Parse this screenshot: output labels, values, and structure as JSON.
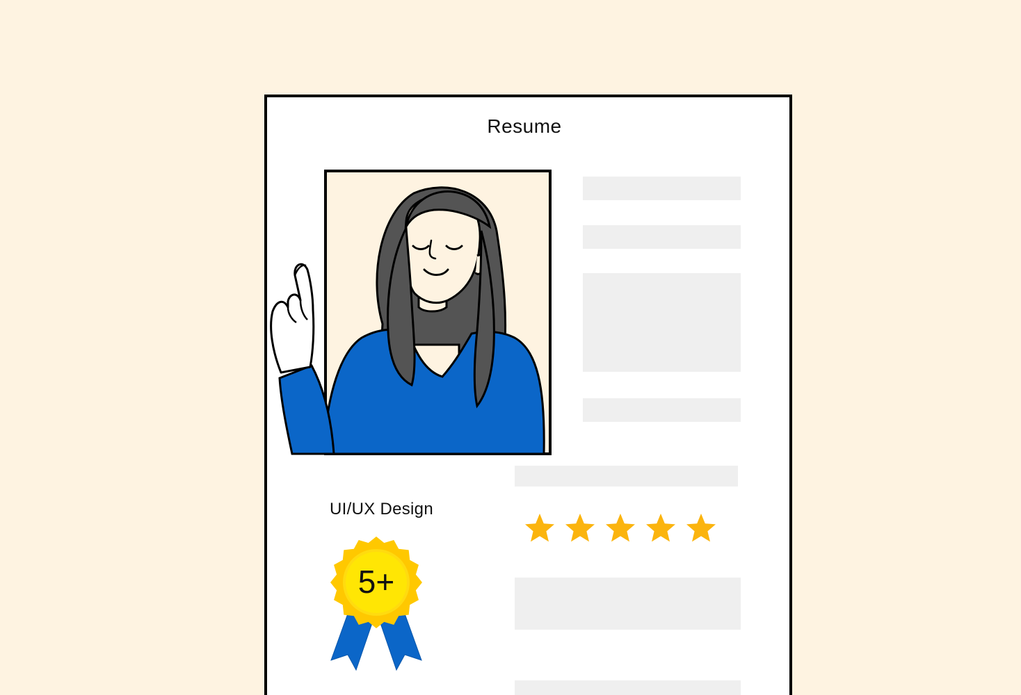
{
  "resume": {
    "title": "Resume",
    "skill": {
      "label": "UI/UX Design",
      "rating": 5,
      "rating_max": 5,
      "experience_badge": "5+"
    }
  },
  "colors": {
    "background": "#FEF3E1",
    "card": "#FFFFFF",
    "placeholder": "#EFEFEF",
    "star": "#FBB40E",
    "badge_gold": "#FFC800",
    "ribbon_blue": "#0B66C8",
    "shirt_blue": "#0B66C8",
    "hair": "#545454"
  },
  "icons": {
    "star": "star-icon",
    "badge": "award-ribbon-icon",
    "portrait": "person-crossed-fingers-illustration"
  }
}
